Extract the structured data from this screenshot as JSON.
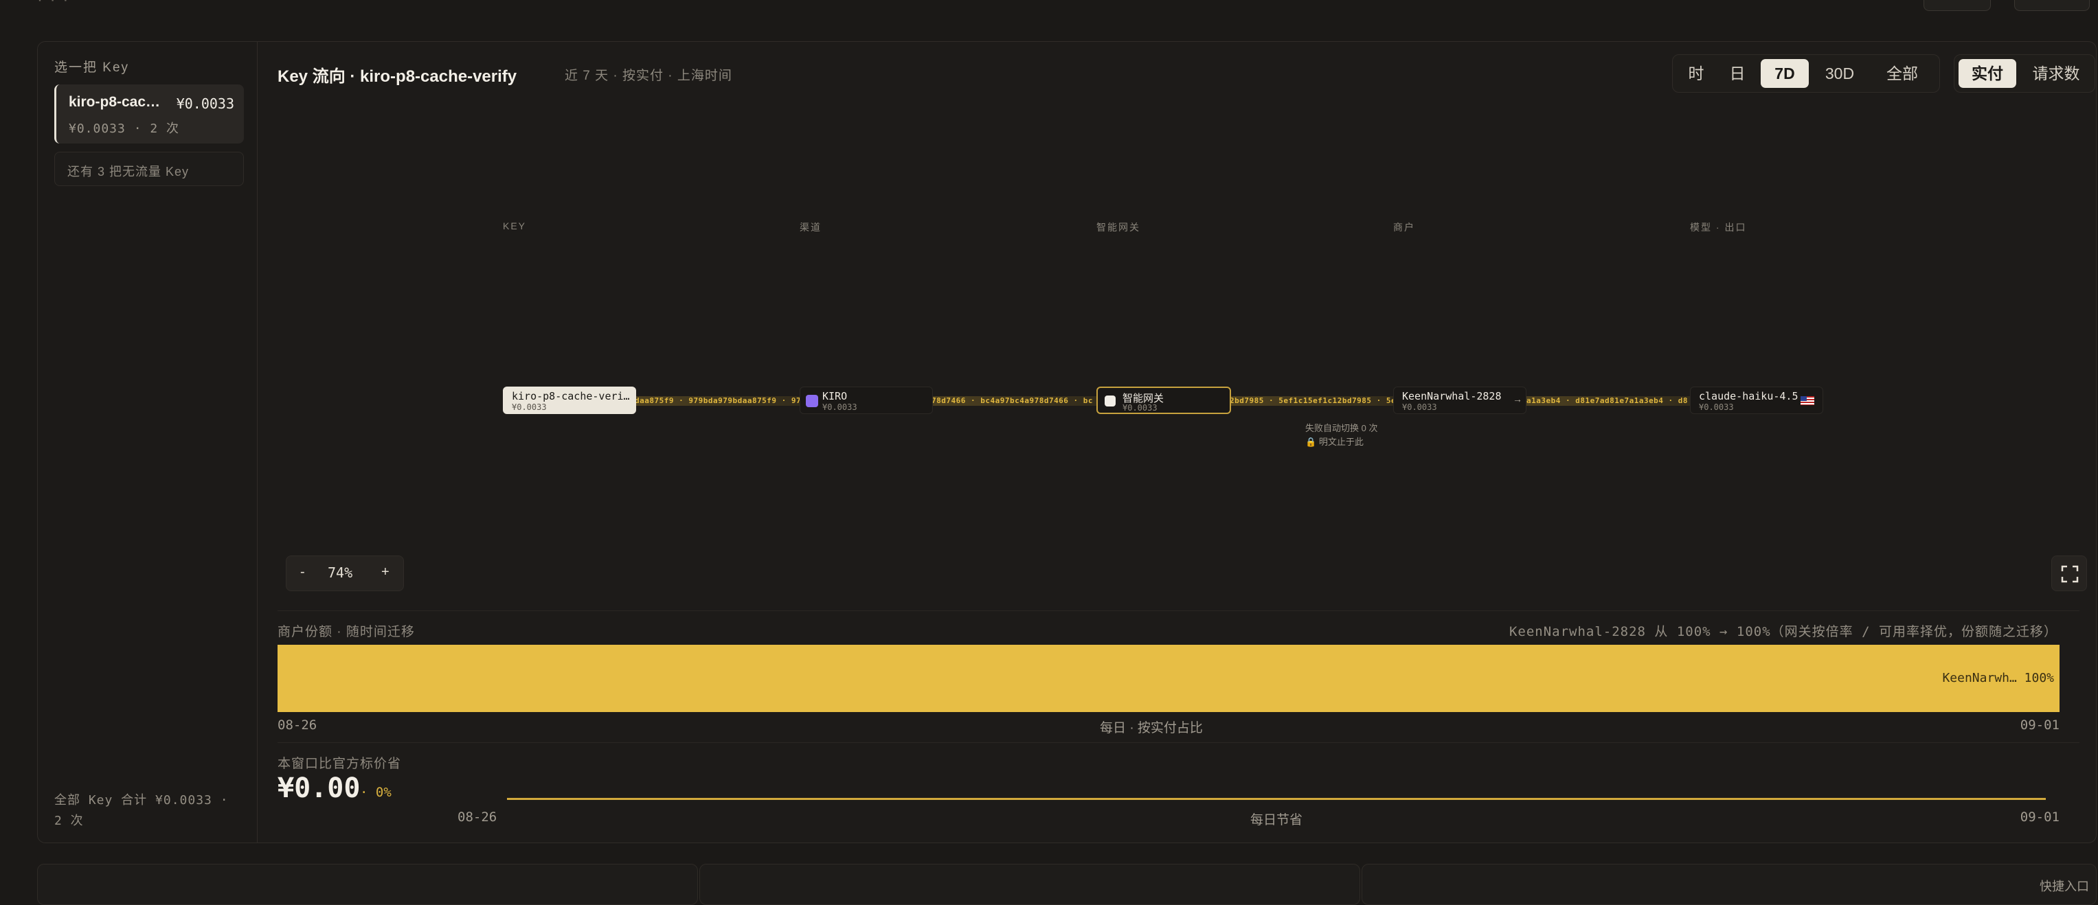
{
  "sidebar": {
    "title": "选一把 Key",
    "selected_key": {
      "name": "kiro-p8-cac…",
      "cost": "¥0.0033",
      "sub": "¥0.0033 · 2 次"
    },
    "more_keys": "还有 3 把无流量 Key",
    "total": "全部 Key 合计 ¥0.0033 · 2 次"
  },
  "header": {
    "title": "Key 流向 · kiro-p8-cache-verify",
    "meta": "近 7 天 · 按实付 · 上海时间",
    "range_options": [
      "时",
      "日",
      "7D",
      "30D",
      "全部"
    ],
    "range_selected": "7D",
    "metric_options": [
      "实付",
      "请求数"
    ],
    "metric_selected": "实付"
  },
  "flow": {
    "columns": [
      "KEY",
      "渠道",
      "智能网关",
      "商户",
      "模型 · 出口"
    ],
    "nodes": {
      "key": {
        "label": "kiro-p8-cache-veri…",
        "value": "¥0.0033"
      },
      "channel": {
        "label": "KIRO",
        "value": "¥0.0033",
        "icon_color": "#8b6cf0"
      },
      "gateway": {
        "label": "智能网关",
        "value": "¥0.0033",
        "failover": "失败自动切换 0 次",
        "lock": "明文止于此"
      },
      "merchant": {
        "label": "KeenNarwhal-2828",
        "value": "¥0.0033"
      },
      "model": {
        "label": "claude-haiku-4.5",
        "value": "¥0.0033",
        "flag": "us-flag-icon"
      }
    },
    "links": [
      "daa875f9 · 979bda979bdaa875f9 · 97",
      "78d7466 · bc4a97bc4a978d7466 · bc",
      "2bd7985 · 5ef1c15ef1c12bd7985 · 5e",
      "a1a3eb4 · d81e7ad81e7a1a3eb4 · d8"
    ],
    "link_arrow": "→",
    "zoom": "74%",
    "zoom_out": "-",
    "zoom_in": "+"
  },
  "share": {
    "title": "商户份额 · 随时间迁移",
    "note": "KeenNarwhal-2828 从 100% → 100%（网关按倍率 / 可用率择优，份额随之迁移）",
    "segment_label": "KeenNarwh… 100%",
    "x_start": "08-26",
    "x_mid": "每日 · 按实付占比",
    "x_end": "09-01",
    "color": "#e7be45"
  },
  "savings": {
    "title": "本窗口比官方标价省",
    "amount": "¥0.00",
    "pct": "· 0%",
    "x_start": "08-26",
    "x_mid": "每日节省",
    "x_end": "09-01"
  },
  "bottom": {
    "quick_entry": "快捷入口"
  }
}
